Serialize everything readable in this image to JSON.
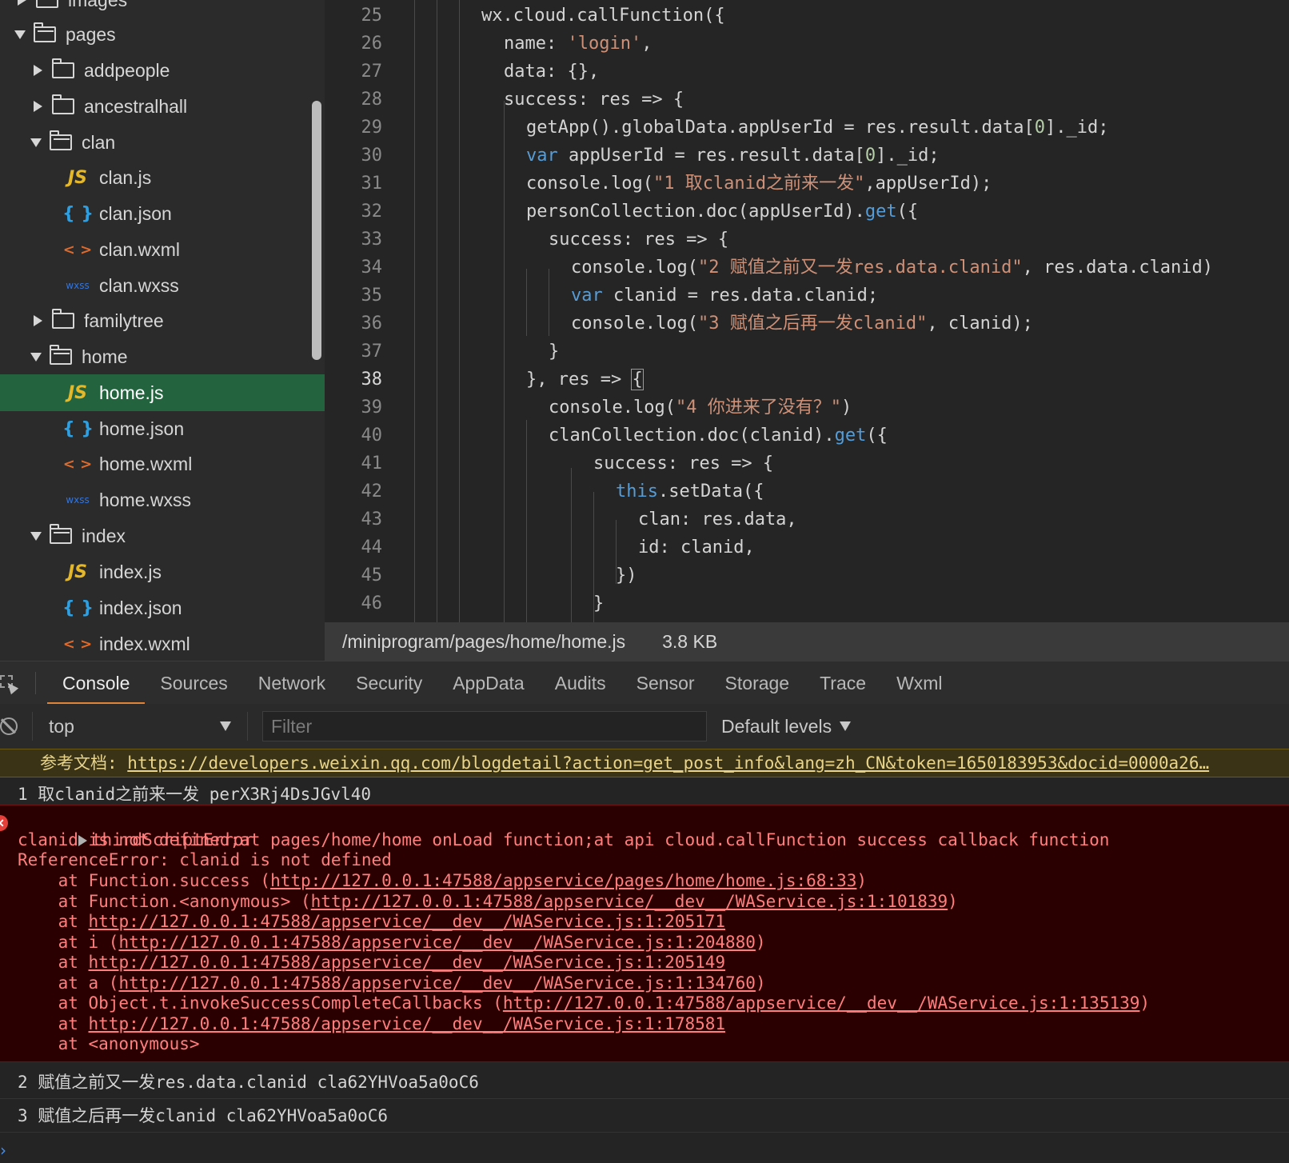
{
  "tree": {
    "items": [
      {
        "label": "images",
        "type": "folder",
        "state": "collapsed"
      },
      {
        "label": "pages",
        "type": "folder",
        "state": "expanded"
      },
      {
        "label": "addpeople",
        "type": "folder",
        "state": "collapsed"
      },
      {
        "label": "ancestralhall",
        "type": "folder",
        "state": "collapsed"
      },
      {
        "label": "clan",
        "type": "folder",
        "state": "expanded"
      },
      {
        "label": "clan.js",
        "type": "js"
      },
      {
        "label": "clan.json",
        "type": "json"
      },
      {
        "label": "clan.wxml",
        "type": "wxml"
      },
      {
        "label": "clan.wxss",
        "type": "wxss"
      },
      {
        "label": "familytree",
        "type": "folder",
        "state": "collapsed"
      },
      {
        "label": "home",
        "type": "folder",
        "state": "expanded"
      },
      {
        "label": "home.js",
        "type": "js",
        "selected": true
      },
      {
        "label": "home.json",
        "type": "json"
      },
      {
        "label": "home.wxml",
        "type": "wxml"
      },
      {
        "label": "home.wxss",
        "type": "wxss"
      },
      {
        "label": "index",
        "type": "folder",
        "state": "expanded"
      },
      {
        "label": "index.js",
        "type": "js"
      },
      {
        "label": "index.json",
        "type": "json"
      },
      {
        "label": "index.wxml",
        "type": "wxml"
      }
    ],
    "icon_glyphs": {
      "js": "JS",
      "json": "{ }",
      "wxml": "< >",
      "wxss": "wxss"
    }
  },
  "editor": {
    "active_line": 38,
    "lines": [
      {
        "n": "25",
        "segs": [
          [
            "p",
            "wx.cloud.callFunction({"
          ]
        ]
      },
      {
        "n": "26",
        "segs": [
          [
            "p",
            "name: "
          ],
          [
            "s",
            "'login'"
          ],
          [
            "p",
            ","
          ]
        ]
      },
      {
        "n": "27",
        "segs": [
          [
            "p",
            "data: {},"
          ]
        ]
      },
      {
        "n": "28",
        "segs": [
          [
            "p",
            "success: res => {"
          ]
        ]
      },
      {
        "n": "29",
        "segs": [
          [
            "p",
            "getApp().globalData.appUserId = res.result.data["
          ],
          [
            "n",
            "0"
          ],
          [
            "p",
            "]._id;"
          ]
        ]
      },
      {
        "n": "30",
        "segs": [
          [
            "k",
            "var"
          ],
          [
            "p",
            " appUserId = res.result.data["
          ],
          [
            "n",
            "0"
          ],
          [
            "p",
            "]._id;"
          ]
        ]
      },
      {
        "n": "31",
        "segs": [
          [
            "p",
            "console.log("
          ],
          [
            "s",
            "\"1 取clanid之前来一发\""
          ],
          [
            "p",
            ",appUserId);"
          ]
        ]
      },
      {
        "n": "32",
        "segs": [
          [
            "p",
            "personCollection.doc(appUserId)."
          ],
          [
            "k",
            "get"
          ],
          [
            "p",
            "({"
          ]
        ]
      },
      {
        "n": "33",
        "segs": [
          [
            "p",
            "success: res => {"
          ]
        ]
      },
      {
        "n": "34",
        "segs": [
          [
            "p",
            "console.log("
          ],
          [
            "s",
            "\"2 赋值之前又一发res.data.clanid\""
          ],
          [
            "p",
            ", res.data.clanid)"
          ]
        ]
      },
      {
        "n": "35",
        "segs": [
          [
            "k",
            "var"
          ],
          [
            "p",
            " clanid = res.data.clanid;"
          ]
        ]
      },
      {
        "n": "36",
        "segs": [
          [
            "p",
            "console.log("
          ],
          [
            "s",
            "\"3 赋值之后再一发clanid\""
          ],
          [
            "p",
            ", clanid);"
          ]
        ]
      },
      {
        "n": "37",
        "segs": [
          [
            "p",
            "}"
          ]
        ]
      },
      {
        "n": "38",
        "segs": [
          [
            "p",
            "}, res => "
          ],
          [
            "b",
            "{"
          ]
        ]
      },
      {
        "n": "39",
        "segs": [
          [
            "p",
            "console.log("
          ],
          [
            "s",
            "\"4 你进来了没有？\""
          ],
          [
            "p",
            ")"
          ]
        ]
      },
      {
        "n": "40",
        "segs": [
          [
            "p",
            "clanCollection.doc(clanid)."
          ],
          [
            "k",
            "get"
          ],
          [
            "p",
            "({"
          ]
        ]
      },
      {
        "n": "41",
        "segs": [
          [
            "p",
            "success: res => {"
          ]
        ]
      },
      {
        "n": "42",
        "segs": [
          [
            "k",
            "this"
          ],
          [
            "p",
            ".setData({"
          ]
        ]
      },
      {
        "n": "43",
        "segs": [
          [
            "p",
            "clan: res.data,"
          ]
        ]
      },
      {
        "n": "44",
        "segs": [
          [
            "p",
            "id: clanid,"
          ]
        ]
      },
      {
        "n": "45",
        "segs": [
          [
            "p",
            "})"
          ]
        ]
      },
      {
        "n": "46",
        "segs": [
          [
            "p",
            "}"
          ]
        ]
      }
    ]
  },
  "status": {
    "path": "/miniprogram/pages/home/home.js",
    "size": "3.8 KB"
  },
  "devtools": {
    "tabs": [
      "Console",
      "Sources",
      "Network",
      "Security",
      "AppData",
      "Audits",
      "Sensor",
      "Storage",
      "Trace",
      "Wxml"
    ],
    "active_tab": "Console",
    "context": "top",
    "filter_placeholder": "Filter",
    "levels": "Default levels"
  },
  "console": {
    "warning": {
      "prefix": "参考文档: ",
      "link": "https://developers.weixin.qq.com/blogdetail?action=get_post_info&lang=zh_CN&token=1650183953&docid=0000a26…"
    },
    "log1": "1 取clanid之前来一发 perX3Rj4DsJGvl40",
    "error": {
      "title": "thirdScriptError",
      "message": "clanid is not defined;at pages/home/home onLoad function;at api cloud.callFunction success callback function",
      "ref": "ReferenceError: clanid is not defined",
      "stack": [
        {
          "pre": "    at Function.success (",
          "link": "http://127.0.0.1:47588/appservice/pages/home/home.js:68:33",
          "post": ")"
        },
        {
          "pre": "    at Function.<anonymous> (",
          "link": "http://127.0.0.1:47588/appservice/__dev__/WAService.js:1:101839",
          "post": ")"
        },
        {
          "pre": "    at ",
          "link": "http://127.0.0.1:47588/appservice/__dev__/WAService.js:1:205171",
          "post": ""
        },
        {
          "pre": "    at i (",
          "link": "http://127.0.0.1:47588/appservice/__dev__/WAService.js:1:204880",
          "post": ")"
        },
        {
          "pre": "    at ",
          "link": "http://127.0.0.1:47588/appservice/__dev__/WAService.js:1:205149",
          "post": ""
        },
        {
          "pre": "    at a (",
          "link": "http://127.0.0.1:47588/appservice/__dev__/WAService.js:1:134760",
          "post": ")"
        },
        {
          "pre": "    at Object.t.invokeSuccessCompleteCallbacks (",
          "link": "http://127.0.0.1:47588/appservice/__dev__/WAService.js:1:135139",
          "post": ")"
        },
        {
          "pre": "    at ",
          "link": "http://127.0.0.1:47588/appservice/__dev__/WAService.js:1:178581",
          "post": ""
        },
        {
          "pre": "    at <anonymous>",
          "link": "",
          "post": ""
        }
      ]
    },
    "log2": "2 赋值之前又一发res.data.clanid cla62YHVoa5a0oC6",
    "log3": "3 赋值之后再一发clanid cla62YHVoa5a0oC6"
  }
}
